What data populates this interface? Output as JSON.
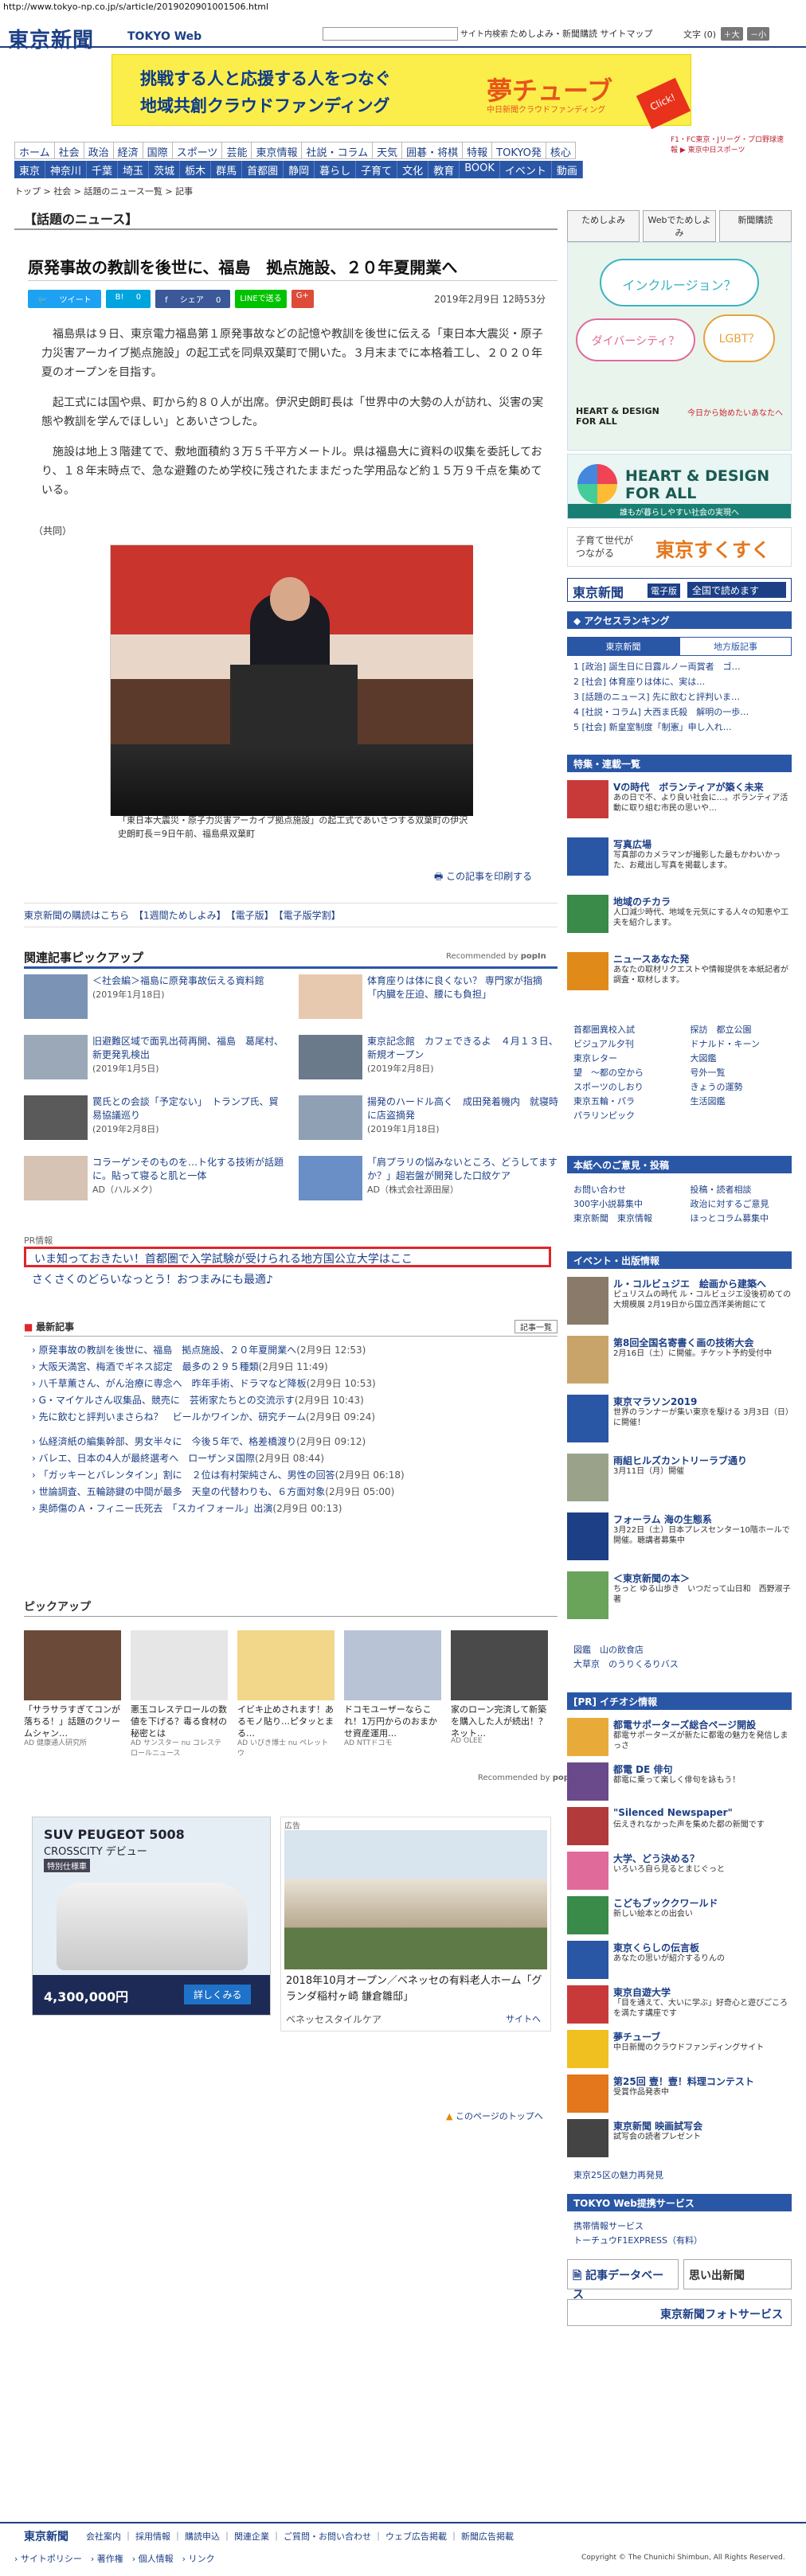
{
  "url": "http://www.tokyo-np.co.jp/s/article/2019020901001506.html",
  "header": {
    "logo": "東京新聞",
    "logo_sub": "TOKYO Web",
    "search_button": "サイト内検索",
    "links": "ためしよみ・新聞購読 サイトマップ",
    "font_label": "文字",
    "font_value": "(0)",
    "font_plus": "＋大",
    "font_minus": "－小"
  },
  "banner": {
    "line1": "挑戦する人と応援する人をつなぐ",
    "line2": "地域共創クラウドファンディング",
    "logo": "夢チューブ",
    "logo_sub": "中日新聞クラウドファンディング",
    "click": "Click!"
  },
  "corner_ad": "F1・FC東京・Jリーグ・プロ野球速報 ▶ 東京中日スポーツ",
  "nav_primary": [
    "ホーム",
    "社会",
    "政治",
    "経済",
    "国際",
    "スポーツ",
    "芸能",
    "東京情報",
    "社説・コラム",
    "天気",
    "囲碁・将棋",
    "特報",
    "TOKYO発",
    "核心"
  ],
  "nav_secondary": [
    "東京",
    "神奈川",
    "千葉",
    "埼玉",
    "茨城",
    "栃木",
    "群馬",
    "首都圏",
    "静岡",
    "暮らし",
    "子育て",
    "文化",
    "教育",
    "BOOK",
    "イベント",
    "動画"
  ],
  "breadcrumb": "トップ > 社会 > 話題のニュース一覧 > 記事",
  "section_title": "【話題のニュース】",
  "article": {
    "title": "原発事故の教訓を後世に、福島　拠点施設、２０年夏開業へ",
    "share": [
      "ツイート",
      "B!",
      "シェア",
      "LINEで送る",
      "G+"
    ],
    "share_counts": [
      "0",
      "0"
    ],
    "date": "2019年2月9日 12時53分",
    "paragraphs": [
      "福島県は９日、東京電力福島第１原発事故などの記憶や教訓を後世に伝える「東日本大震災・原子力災害アーカイブ拠点施設」の起工式を同県双葉町で開いた。３月末までに本格着工し、２０２０年夏のオープンを目指す。",
      "起工式には国や県、町から約８０人が出席。伊沢史朗町長は「世界中の大勢の人が訪れ、災害の実態や教訓を学んでほしい」とあいさつした。",
      "施設は地上３階建てで、敷地面積約３万５千平方メートル。県は福島大に資料の収集を委託しており、１８年末時点で、急な避難のため学校に残されたままだった学用品など約１５万９千点を集めている。"
    ],
    "credit": "（共同）",
    "caption": "「東日本大震災・原子力災害アーカイブ拠点施設」の起工式であいさつする双葉町の伊沢史朗町長＝9日午前、福島県双葉町",
    "print_link": "この記事を印刷する"
  },
  "subscribe_links": "東京新聞の購読はこちら　【1週間ためしよみ】　【電子版】　【電子版学割】",
  "related": {
    "title": "関連記事ピックアップ",
    "recommended": "Recommended by",
    "popin": "popIn",
    "items": [
      {
        "text": "＜社会編＞福島に原発事故伝える資料館",
        "date": "(2019年1月18日)"
      },
      {
        "text": "体育座りは体に良くない？ 専門家が指摘「内臓を圧迫、腰にも負担」",
        "date": ""
      },
      {
        "text": "旧避難区域で面乳出荷再開、福島　葛尾村、新更発乳検出",
        "date": "(2019年1月5日)"
      },
      {
        "text": "東京記念館　カフェできるよ　４月１３日、新規オープン",
        "date": "(2019年2月8日)"
      },
      {
        "text": "罠氏との会談「予定ない」　トランプ氏、貿易協議巡り",
        "date": "(2019年2月8日)"
      },
      {
        "text": "揚発のハードル高く　成田発着機内　就寝時に店盗摘発",
        "date": "(2019年1月18日)"
      },
      {
        "text": "コラーゲンそのものを…ト化する技術が話題に。貼って寝ると肌と一体",
        "date": "AD（ハルメク）"
      },
      {
        "text": "「肩プラリの悩みないところ、どうしてますか？」超岩盤が開発した口紋ケア",
        "date": "AD（株式会社源田屋）"
      }
    ]
  },
  "pr_notice": "PR情報",
  "pr_red": "いま知っておきたい！首都圏で入学試験が受けられる地方国公立大学はここ",
  "pr_second": "さくさくのどらいなっとう！おつまみにも最適♪",
  "latest": {
    "title": "最新記事",
    "more": "記事一覧",
    "items": [
      {
        "t": "原発事故の教訓を後世に、福島　拠点施設、２０年夏開業へ",
        "d": "(2月9日 12:53)"
      },
      {
        "t": "大阪天満宮、梅酒でギネス認定　最多の２９５種類",
        "d": "(2月9日 11:49)"
      },
      {
        "t": "八千草薫さん、がん治療に専念へ　昨年手術、ドラマなど降板",
        "d": "(2月9日 10:53)"
      },
      {
        "t": "G・マイケルさん収集品、競売に　芸術家たちとの交流示す",
        "d": "(2月9日 10:43)"
      },
      {
        "t": "先に飲むと評判いまさらね？　ビールかワインか、研究チーム",
        "d": "(2月9日 09:24)"
      },
      {
        "t": "仏経済紙の編集幹部、男女半々に　今後５年で、格差橋渡り",
        "d": "(2月9日 09:12)"
      },
      {
        "t": "バレエ、日本の4人が最終選考へ　ローザンヌ国際",
        "d": "(2月9日 08:44)"
      },
      {
        "t": "「ガッキーとバレンタイン」割に　２位は有村架純さん、男性の回答",
        "d": "(2月9日 06:18)"
      },
      {
        "t": "世論調査、五輪跡鍵の中間が最多　天皇の代替わりも、６方面対象",
        "d": "(2月9日 05:00)"
      },
      {
        "t": "奥師傷のＡ・フィニー氏死去　「スカイフォール」出演",
        "d": "(2月9日 00:13)"
      }
    ]
  },
  "pickup": {
    "title": "ピックアップ",
    "items": [
      {
        "t": "「サラサラすぎてコンが落ちる！」話題のクリームシャン…",
        "ad": "AD 健康通人研究所"
      },
      {
        "t": "悪玉コレステロールの数値を下げる？毒る食材の秘密とは",
        "ad": "AD サンスター nu コレステロールニュース"
      },
      {
        "t": "イビキ止めされます！あるモノ貼り…ピタッとまる…",
        "ad": "AD いびき博士 nu ペレットウ"
      },
      {
        "t": "ドコモユーザーならこれ！1万円からのおまかせ資産運用…",
        "ad": "AD NTTドコモ"
      },
      {
        "t": "家のローン完済して新築を購入した人が続出！？ネット…",
        "ad": "AD OLEE"
      }
    ]
  },
  "ads": {
    "car_brand": "SUV PEUGEOT 5008",
    "car_model": "CROSSCITY デビュー",
    "car_badge": "特別仕様車",
    "car_price": "4,300,000円",
    "car_btn": "詳しくみる",
    "house_label": "広告",
    "house_text": "2018年10月オープン／ベネッセの有料老人ホーム「グランダ稲村ヶ崎 鎌倉雛邸」",
    "house_brand": "ベネッセスタイルケア",
    "house_site": "サイトへ"
  },
  "page_top": "このページのトップへ",
  "sidebar": {
    "tabs": [
      "ためしよみ",
      "Webでためしよみ",
      "新聞購読"
    ],
    "ad1_l1": "インクルージョン？",
    "ad1_l2": "ダイバーシティ？",
    "ad1_l3": "LGBT？",
    "ad1_tag": "HEART & DESIGN FOR ALL",
    "ad1_q": "誰もが生きやすい社会の実現へ",
    "ad1_cta": "今日から始めたいあなたへ",
    "ad2": "HEART & DESIGN FOR ALL",
    "ad2_sub": "誰もが暮らしやすい社会の実現へ",
    "ad3_a": "子育て世代がつながる",
    "ad3_b": "東京すくすく",
    "ad4_logo": "東京新聞",
    "ad4_tag": "電子版",
    "ad4_txt": "全国で読めます",
    "ranking": {
      "title": "アクセスランキング",
      "tabs": [
        "東京新聞",
        "地方版記事"
      ],
      "items": [
        "1 [政治] 誕生日に日露ルノー両賞者　ゴ…",
        "2 [社会] 体育座りは体に、実は…",
        "3 [話題のニュース] 先に飲むと評判いま…",
        "4 [社説・コラム] 大西ま氏殺　解明の一歩…",
        "5 [社会] 新皇室制度「制憲」申し入れ…"
      ]
    },
    "feature": {
      "title": "特集・連載一覧",
      "items": [
        {
          "t": "Vの時代　ボランティアが築く未来",
          "d": "あの日で不、より良い社会に…。ボランティア活動に取り組む市民の思いや…"
        },
        {
          "t": "写真広場",
          "d": "写真部のカメラマンが撮影した最もかわいかった、お蔵出し写真を掲載します。"
        },
        {
          "t": "地域のチカラ",
          "d": "人口減少時代、地域を元気にする人々の知恵や工夫を紹介します。"
        },
        {
          "t": "ニュースあなた発",
          "d": "あなたの取材リクエストや情報提供を本紙記者が調査・取材します。"
        }
      ],
      "list": [
        "首都圏異校入試",
        "ビジュアル夕刊",
        "東京レター",
        "望　～都の空から",
        "スポーツのしおり",
        "東京五輪・パラ",
        "パラリンピック",
        "探訪　都立公園",
        "ドナルド・キーン",
        "大図鑑",
        "号外一覧",
        "きょうの運勢",
        "生活図鑑"
      ]
    },
    "reader": {
      "title": "本紙へのご意見・投稿",
      "list": [
        "お問い合わせ",
        "300字小説募集中",
        "東京新聞　東京情報",
        "投稿・読者相談",
        "政治に対するご意見",
        "ほっとコラム募集中"
      ]
    },
    "events": {
      "title": "イベント・出版情報",
      "items": [
        {
          "t": "ル・コルビュジエ　絵画から建築へ",
          "d": "ピュリスムの時代 ル・コルビュジエ没後初めての大規模展 2月19日から国立西洋美術館にて"
        },
        {
          "t": "第8回全国名寄書く画の技術大会",
          "d": "2月16日（土）に開催。チケット予約受付中"
        },
        {
          "t": "東京マラソン2019",
          "d": "世界のランナーが集い東京を駆ける 3月3日（日）に開催！"
        },
        {
          "t": "雨組ヒルズカントリーラブ通り",
          "d": "3月11日（月）開催"
        },
        {
          "t": "フォーラム 海の生態系",
          "d": "3月22日（土）日本プレスセンター10階ホールで開催。聴講者募集中"
        },
        {
          "t": "＜東京新聞の本＞",
          "d": "ちっと ゆる山歩き　いつだって山日和　西野淑子 著"
        }
      ],
      "list": [
        "図鑑　山の飲食店",
        "大草京　のうりくるりバス"
      ]
    },
    "pr": {
      "title": "[PR] イチオシ情報",
      "items": [
        {
          "t": "都電サポーターズ総合ページ開設",
          "d": "都電サポーターズが新たに都電の魅力を発信しまっさ"
        },
        {
          "t": "都電 DE 俳句",
          "d": "都電に乗って楽しく俳句を詠もう！"
        },
        {
          "t": "\"Silenced Newspaper\"",
          "d": "伝えきれなかった声を集めた都の新聞です"
        },
        {
          "t": "大学、どう決める？",
          "d": "いろいろ自ら見るとまじぐっと"
        },
        {
          "t": "こどもブッククワールド",
          "d": "新しい絵本との出会い"
        },
        {
          "t": "東京くらしの伝言板",
          "d": "あなたの思いが紹介するりんの"
        },
        {
          "t": "東京自遊大学",
          "d": "「目を通えて、大いに学ぶ」好奇心と遊びごころを満たす講座です"
        },
        {
          "t": "夢チューブ",
          "d": "中日新聞のクラウドファンディングサイト"
        },
        {
          "t": "第25回 壹！壹！料理コンテスト",
          "d": "受賞作品発表中"
        },
        {
          "t": "東京新聞 映画試写会",
          "d": "試写会の読者プレゼント"
        }
      ],
      "more": "東京25区の魅力再発見"
    },
    "service": {
      "title": "TOKYO Web提携サービス",
      "list": [
        "携帯情報サービス",
        "トーチュウF1EXPRESS（有料）"
      ]
    },
    "db": "記事データベース",
    "photo": "東京新聞フォトサービス",
    "memorial": "思い出新聞"
  },
  "footer": {
    "logo": "東京新聞",
    "links": "会社案内 ｜ 採用情報 ｜ 購読申込 ｜ 関連企業 ｜ ご質問・お問い合わせ ｜ ウェブ広告掲載 ｜ 新聞広告掲載",
    "links2": "› サイトポリシー　› 著作権　› 個人情報　› リンク",
    "copyright": "Copyright © The Chunichi Shimbun, All Rights Reserved."
  }
}
